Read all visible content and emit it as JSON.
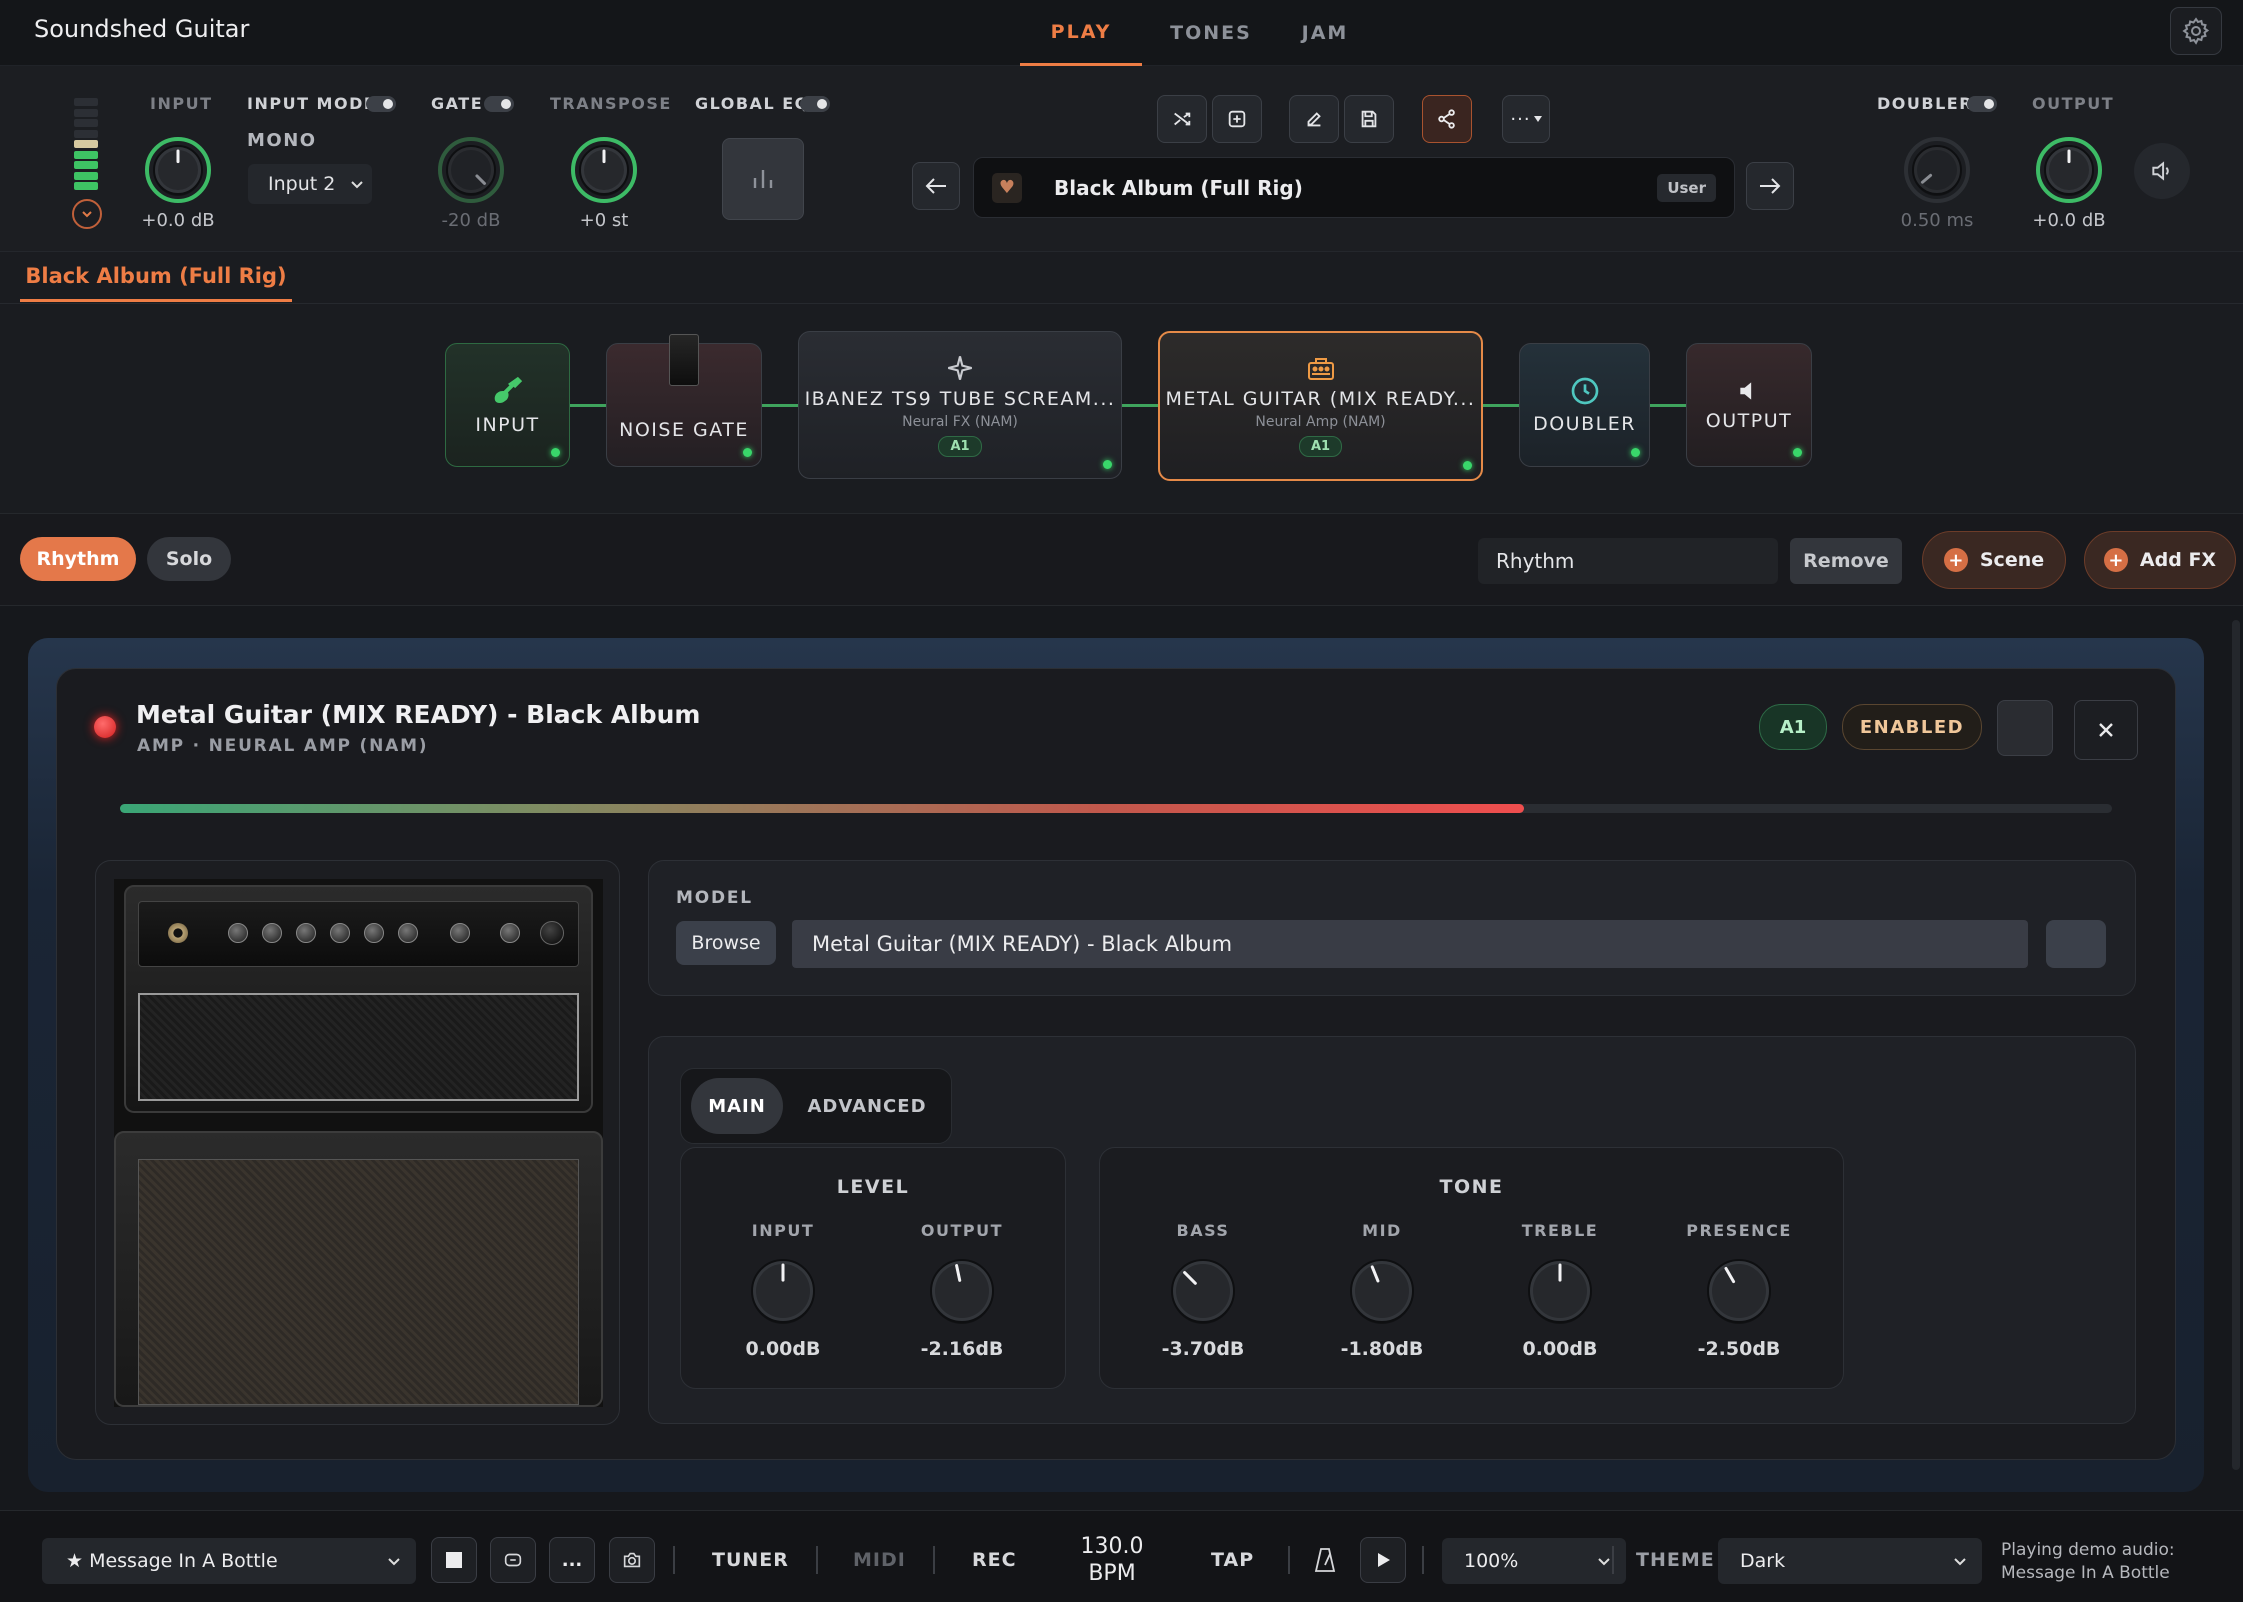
{
  "app": {
    "title": "Soundshed Guitar"
  },
  "nav": {
    "tabs": [
      {
        "label": "PLAY"
      },
      {
        "label": "TONES"
      },
      {
        "label": "JAM"
      }
    ],
    "active": "PLAY"
  },
  "header": {
    "input": {
      "label": "INPUT",
      "value": "+0.0 dB"
    },
    "input_mode": {
      "label": "INPUT MODE",
      "mode": "MONO",
      "selected": "Input 2"
    },
    "gate": {
      "label": "GATE",
      "value": "-20 dB"
    },
    "transpose": {
      "label": "TRANSPOSE",
      "value": "+0 st"
    },
    "global_eq": {
      "label": "GLOBAL EQ"
    },
    "preset": {
      "name": "Black Album (Full Rig)",
      "tag": "User"
    },
    "doubler": {
      "label": "DOUBLER",
      "value": "0.50 ms"
    },
    "output": {
      "label": "OUTPUT",
      "value": "+0.0 dB"
    },
    "input_meter_level": 0.55
  },
  "preset_tab": {
    "label": "Black Album (Full Rig)"
  },
  "chain": {
    "nodes": [
      {
        "title": "INPUT"
      },
      {
        "title": "NOISE GATE"
      },
      {
        "title": "IBANEZ TS9 TUBE SCREAM...",
        "subtitle": "Neural FX (NAM)",
        "badge": "A1"
      },
      {
        "title": "METAL GUITAR (MIX READY...",
        "subtitle": "Neural Amp (NAM)",
        "badge": "A1"
      },
      {
        "title": "DOUBLER"
      },
      {
        "title": "OUTPUT"
      }
    ]
  },
  "scenes": {
    "items": [
      {
        "label": "Rhythm"
      },
      {
        "label": "Solo"
      }
    ],
    "active": "Rhythm",
    "name_value": "Rhythm",
    "remove_label": "Remove",
    "scene_label": "Scene",
    "add_fx_label": "Add FX"
  },
  "module": {
    "title": "Metal Guitar (MIX READY) - Black Album",
    "subtitle": "AMP · NEURAL AMP (NAM)",
    "badge": "A1",
    "status": "ENABLED",
    "level_meter": 0.705,
    "model_label": "MODEL",
    "browse_label": "Browse",
    "model_value": "Metal Guitar (MIX READY) - Black Album",
    "tabs": [
      {
        "label": "MAIN"
      },
      {
        "label": "ADVANCED"
      }
    ],
    "active_tab": "MAIN",
    "level": {
      "title": "LEVEL",
      "knobs": [
        {
          "label": "INPUT",
          "value": "0.00dB"
        },
        {
          "label": "OUTPUT",
          "value": "-2.16dB"
        }
      ]
    },
    "tone": {
      "title": "TONE",
      "knobs": [
        {
          "label": "BASS",
          "value": "-3.70dB"
        },
        {
          "label": "MID",
          "value": "-1.80dB"
        },
        {
          "label": "TREBLE",
          "value": "0.00dB"
        },
        {
          "label": "PRESENCE",
          "value": "-2.50dB"
        }
      ]
    }
  },
  "bottom": {
    "track": "★ Message In A Bottle",
    "more": "...",
    "tuner": "TUNER",
    "midi": "MIDI",
    "rec": "REC",
    "bpm_value": "130.0",
    "bpm_unit": "BPM",
    "tap": "TAP",
    "zoom": "100%",
    "theme_label": "THEME",
    "theme_value": "Dark",
    "status_line1": "Playing demo audio:",
    "status_line2": "Message In A Bottle"
  },
  "colors": {
    "accent": "#ee7d45",
    "active_green": "#39d66a",
    "badge_green": "#1d3a2a"
  }
}
